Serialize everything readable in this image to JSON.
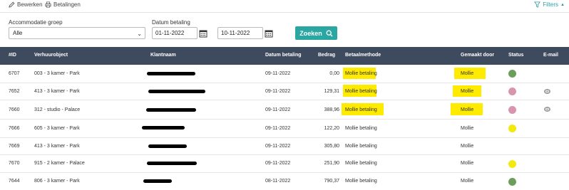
{
  "toolbar": {
    "edit_label": "Bewerken",
    "payments_label": "Betalingen",
    "filters_label": "Filters"
  },
  "filters": {
    "accommodation_label": "Accommodatie groep",
    "accommodation_value": "Alle",
    "date_label": "Datum betaling",
    "date_from": "01-11-2022",
    "date_to": "10-11-2022",
    "search_label": "Zoeken"
  },
  "table": {
    "headers": {
      "id": "#ID",
      "object": "Verhuurobject",
      "customer": "Klantnaam",
      "date": "Datum betaling",
      "amount": "Bedrag",
      "method": "Betaalmethode",
      "made_by": "Gemaakt door",
      "status": "Status",
      "email": "E-mail"
    },
    "rows": [
      {
        "id": "6707",
        "object": "003 - 3 kamer - Park",
        "date": "09-11-2022",
        "amount": "0,00",
        "method": "Mollie betaling",
        "made_by": "Mollie",
        "status_color": "#6b9e5a",
        "email_icon": false
      },
      {
        "id": "7652",
        "object": "413 - 3 kamer - Park",
        "date": "09-11-2022",
        "amount": "129,31",
        "method": "Mollie betaling",
        "made_by": "Mollie",
        "status_color": "#d895b0",
        "email_icon": true
      },
      {
        "id": "7660",
        "object": "312 - studio - Palace",
        "date": "09-11-2022",
        "amount": "388,96",
        "method": "Mollie betaling",
        "made_by": "Mollie",
        "status_color": "#d895b0",
        "email_icon": true
      },
      {
        "id": "7666",
        "object": "605 - 3 kamer - Park",
        "date": "09-11-2022",
        "amount": "122,20",
        "method": "Mollie betaling",
        "made_by": "Mollie",
        "status_color": "#f2ea0d",
        "email_icon": false
      },
      {
        "id": "7669",
        "object": "413 - 3 kamer - Park",
        "date": "09-11-2022",
        "amount": "305,80",
        "method": "Mollie betaling",
        "made_by": "Mollie",
        "status_color": "",
        "email_icon": false
      },
      {
        "id": "7670",
        "object": "915 - 2 kamer - Palace",
        "date": "09-11-2022",
        "amount": "251,90",
        "method": "Mollie betaling",
        "made_by": "Mollie",
        "status_color": "#f2ea0d",
        "email_icon": false
      },
      {
        "id": "7644",
        "object": "806 - 3 kamer - Park",
        "date": "08-11-2022",
        "amount": "790,37",
        "method": "Mollie betaling",
        "made_by": "Mollie",
        "status_color": "#6b9e5a",
        "email_icon": false
      }
    ]
  }
}
